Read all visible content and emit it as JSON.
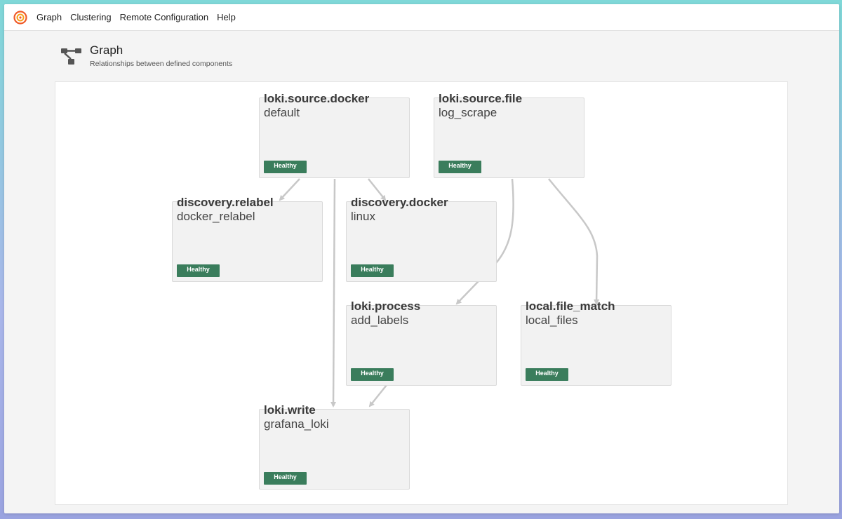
{
  "navbar": {
    "items": [
      "Graph",
      "Clustering",
      "Remote Configuration",
      "Help"
    ]
  },
  "header": {
    "title": "Graph",
    "subtitle": "Relationships between defined components"
  },
  "nodes": [
    {
      "type": "loki.source.docker",
      "name": "default",
      "status": "Healthy"
    },
    {
      "type": "loki.source.file",
      "name": "log_scrape",
      "status": "Healthy"
    },
    {
      "type": "discovery.relabel",
      "name": "docker_relabel",
      "status": "Healthy"
    },
    {
      "type": "discovery.docker",
      "name": "linux",
      "status": "Healthy"
    },
    {
      "type": "loki.process",
      "name": "add_labels",
      "status": "Healthy"
    },
    {
      "type": "local.file_match",
      "name": "local_files",
      "status": "Healthy"
    },
    {
      "type": "loki.write",
      "name": "grafana_loki",
      "status": "Healthy"
    }
  ],
  "colors": {
    "healthy_badge": "#3a7d5c",
    "edge": "#c8c8c8",
    "brand": "#f05a28"
  }
}
